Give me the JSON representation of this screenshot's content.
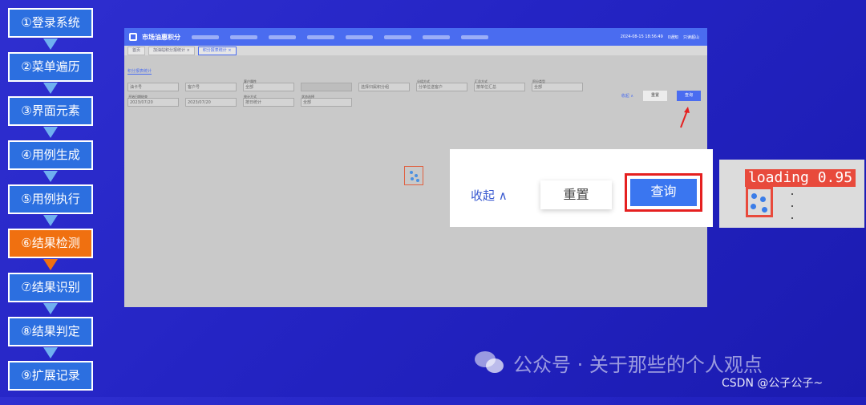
{
  "steps": [
    {
      "label": "①登录系统",
      "active": false
    },
    {
      "label": "②菜单遍历",
      "active": false
    },
    {
      "label": "③界面元素",
      "active": false
    },
    {
      "label": "④用例生成",
      "active": false
    },
    {
      "label": "⑤用例执行",
      "active": false
    },
    {
      "label": "⑥结果检测",
      "active": true
    },
    {
      "label": "⑦结果识别",
      "active": false
    },
    {
      "label": "⑧结果判定",
      "active": false
    },
    {
      "label": "⑨扩展记录",
      "active": false
    }
  ],
  "app": {
    "title": "市场油惠积分",
    "datetime": "2024-08-15 18:56:49",
    "notice": "0通知",
    "user": "只读超山",
    "tabs": [
      "首页",
      "加油站积分报统计 ×",
      "积分报表统计 ×"
    ],
    "subtitle": "积分报表统计",
    "row1": [
      {
        "label": "",
        "value": "油卡号",
        "disabled": false
      },
      {
        "label": "",
        "value": "客户号",
        "disabled": false
      },
      {
        "label": "客户属性",
        "value": "全部",
        "disabled": false
      },
      {
        "label": "",
        "value": "",
        "disabled": true
      },
      {
        "label": "",
        "value": "选择归属积分组",
        "disabled": false
      },
      {
        "label": "分组方式",
        "value": "分单位送客户",
        "disabled": false
      },
      {
        "label": "汇总方式",
        "value": "按单位汇总",
        "disabled": false
      },
      {
        "label": "积分类型",
        "value": "全部",
        "disabled": false
      }
    ],
    "row2": [
      {
        "label": "开始日期结束",
        "value": "2023/07/20",
        "disabled": false
      },
      {
        "label": "",
        "value": "2023/07/20",
        "disabled": false
      },
      {
        "label": "统计方式",
        "value": "按日统计",
        "disabled": false
      },
      {
        "label": "状态选择",
        "value": "全部",
        "disabled": false
      }
    ],
    "collapse": "收起 ∧",
    "reset": "重置",
    "query": "查询"
  },
  "zoom": {
    "collapse": "收起 ∧",
    "reset": "重置",
    "query": "查询"
  },
  "detection": {
    "label": "loading 0.95",
    "class": "loading",
    "confidence": 0.95
  },
  "watermark": {
    "text": "公众号 · 关于那些的个人观点"
  },
  "footer": {
    "text": "CSDN @公子公子~"
  },
  "colors": {
    "step_active": "#f07010",
    "step_default": "#2c6fe0",
    "accent": "#4a6cf0",
    "highlight": "#e52020"
  }
}
